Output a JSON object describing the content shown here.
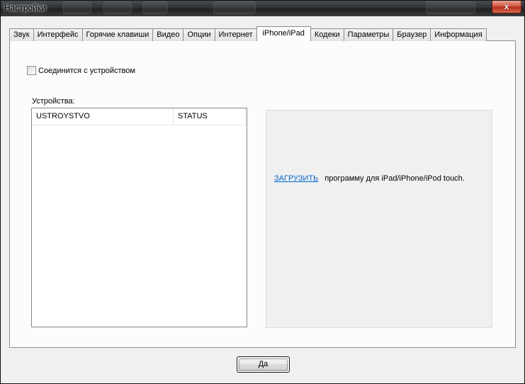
{
  "window": {
    "title": "Настройки",
    "close_glyph": "x"
  },
  "tabs": [
    {
      "label": "Звук",
      "active": false
    },
    {
      "label": "Интерфейс",
      "active": false
    },
    {
      "label": "Горячие клавиши",
      "active": false
    },
    {
      "label": "Видео",
      "active": false
    },
    {
      "label": "Опции",
      "active": false
    },
    {
      "label": "Интернет",
      "active": false
    },
    {
      "label": "iPhone/iPad",
      "active": true
    },
    {
      "label": "Кодеки",
      "active": false
    },
    {
      "label": "Параметры",
      "active": false
    },
    {
      "label": "Браузер",
      "active": false
    },
    {
      "label": "Информация",
      "active": false
    }
  ],
  "connect": {
    "label": "Соединится с устройством",
    "checked": false
  },
  "devices": {
    "label": "Устройства:",
    "columns": [
      "USTROYSTVO",
      "STATUS"
    ],
    "rows": []
  },
  "info": {
    "link_text": "ЗАГРУЗИТЬ",
    "text": "программу для iPad/iPhone/iPod touch."
  },
  "ok_button": {
    "label": "Да"
  },
  "icons": {
    "close": "close-icon",
    "checkbox": "checkbox-icon"
  }
}
